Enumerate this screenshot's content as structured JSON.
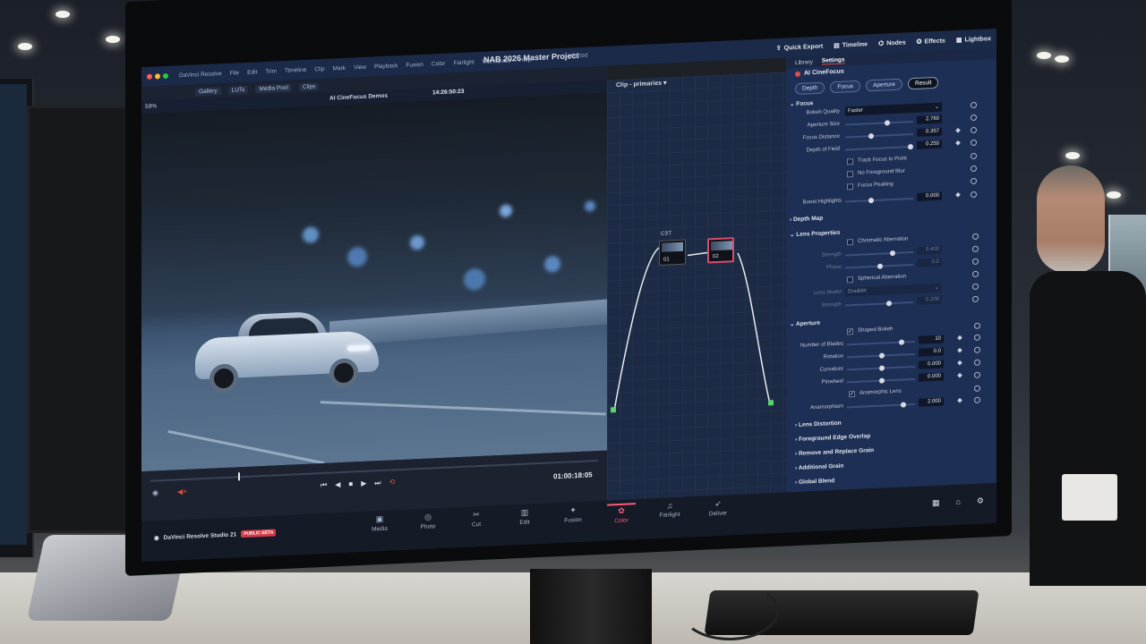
{
  "app": {
    "project_title": "NAB 2026 Master Project",
    "edited_label": "Edited",
    "menu": [
      "DaVinci Resolve",
      "File",
      "Edit",
      "Trim",
      "Timeline",
      "Clip",
      "Mark",
      "View",
      "Playback",
      "Fusion",
      "Color",
      "Fairlight",
      "Workspace",
      "Help"
    ],
    "top_tabs": [
      "Quick Export",
      "Timeline",
      "Nodes",
      "Effects",
      "Lightbox"
    ]
  },
  "toolbar": {
    "items": [
      "Gallery",
      "LUTs",
      "Media Pool",
      "Clips"
    ],
    "zoom": "59%",
    "clip_name": "AI CineFocus Demos",
    "timecode": "14:26:50:23"
  },
  "node_editor": {
    "mode_label": "Clip",
    "mode_value": "primaries",
    "cst_label": "CST",
    "nodes": [
      "01",
      "02"
    ]
  },
  "viewer": {
    "out_timecode": "01:00:18:05"
  },
  "inspector": {
    "tabs": [
      "Library",
      "Settings"
    ],
    "title": "AI CineFocus",
    "mode_buttons": [
      "Depth",
      "Focus",
      "Aperture",
      "Result"
    ],
    "focus": {
      "section": "Focus",
      "bokeh_quality_label": "Bokeh Quality",
      "bokeh_quality_value": "Faster",
      "aperture_size_label": "Aperture Size",
      "aperture_size_value": "2.760",
      "focus_distance_label": "Focus Distance",
      "focus_distance_value": "0.357",
      "depth_of_field_label": "Depth of Field",
      "depth_of_field_value": "0.250",
      "track_focus_label": "Track Focus to Point",
      "no_fg_blur_label": "No Foreground Blur",
      "focus_peaking_label": "Focus Peaking",
      "boost_highlights_label": "Boost Highlights",
      "boost_highlights_value": "0.000"
    },
    "depth_map": "Depth Map",
    "lens": {
      "section": "Lens Properties",
      "chromatic_label": "Chromatic Aberration",
      "strength_label": "Strength",
      "strength_value": "0.400",
      "phase_label": "Phase",
      "phase_value": "0.0",
      "spherical_label": "Spherical Aberration",
      "lens_model_label": "Lens Model",
      "lens_model_value": "Doublet",
      "strength2_label": "Strength",
      "strength2_value": "0.200"
    },
    "aperture": {
      "section": "Aperture",
      "shaped_bokeh_label": "Shaped Bokeh",
      "blades_label": "Number of Blades",
      "blades_value": "10",
      "rotation_label": "Rotation",
      "rotation_value": "0.0",
      "curvature_label": "Curvature",
      "curvature_value": "0.000",
      "pinwheel_label": "Pinwheel",
      "pinwheel_value": "0.000",
      "anamorphic_label": "Anamorphic Lens",
      "anamorphism_label": "Anamorphism",
      "anamorphism_value": "2.000"
    },
    "collapsed_sections": [
      "Lens Distortion",
      "Foreground Edge Overlap",
      "Remove and Replace Grain",
      "Additional Grain",
      "Global Blend"
    ]
  },
  "pagebar": {
    "brand": "DaVinci Resolve Studio 21",
    "beta": "PUBLIC BETA",
    "pages": [
      "Media",
      "Photo",
      "Cut",
      "Edit",
      "Fusion",
      "Color",
      "Fairlight",
      "Deliver"
    ],
    "active_page": "Color"
  },
  "colors": {
    "accent": "#ff5a7a",
    "panel": "#1e2f55",
    "record_red": "#e34b4b"
  }
}
